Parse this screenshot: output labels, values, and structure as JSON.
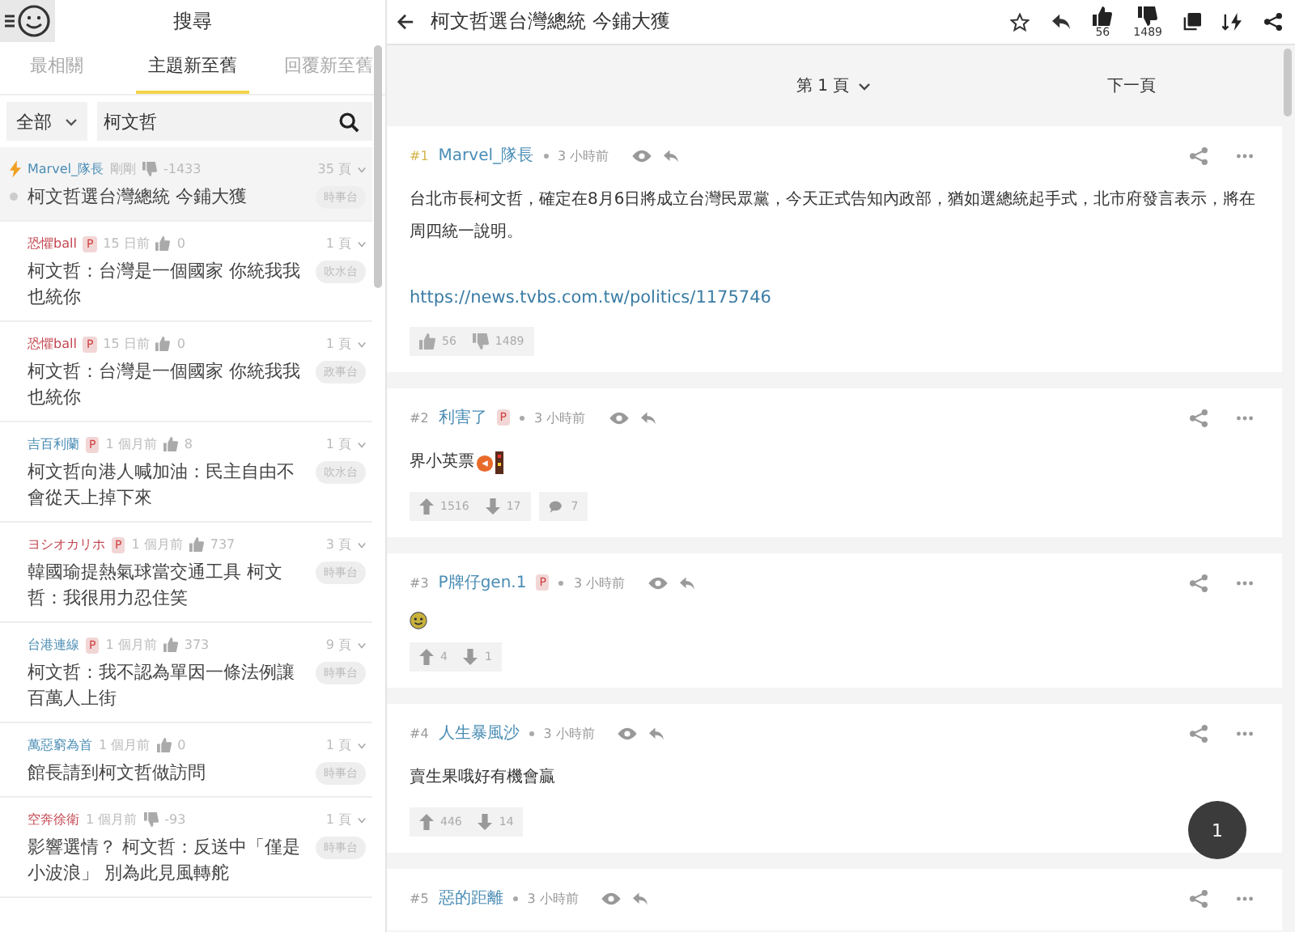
{
  "sidebar": {
    "title": "搜尋",
    "tabs": [
      {
        "label": "最相關",
        "selected": false
      },
      {
        "label": "主題新至舊",
        "selected": true
      },
      {
        "label": "回覆新至舊",
        "selected": false
      }
    ],
    "filter": {
      "value": "全部"
    },
    "search": {
      "value": "柯文哲"
    },
    "threads": [
      {
        "author": "Marvel_隊長",
        "color": "#4a8db5",
        "hot": true,
        "selected": true,
        "time": "剛剛",
        "vote": {
          "kind": "dislike",
          "count": "-1433"
        },
        "pages": "35 頁",
        "title": "柯文哲選台灣總統 今鋪大獲",
        "tag": "時事台"
      },
      {
        "author": "恐懼ball",
        "color": "#c4454f",
        "badge": "P",
        "hot": false,
        "selected": false,
        "time": "15 日前",
        "vote": {
          "kind": "like",
          "count": "0"
        },
        "pages": "1 頁",
        "title": "柯文哲：台灣是一個國家 你統我我也統你",
        "tag": "吹水台"
      },
      {
        "author": "恐懼ball",
        "color": "#c4454f",
        "badge": "P",
        "hot": false,
        "selected": false,
        "time": "15 日前",
        "vote": {
          "kind": "like",
          "count": "0"
        },
        "pages": "1 頁",
        "title": "柯文哲：台灣是一個國家 你統我我也統你",
        "tag": "政事台"
      },
      {
        "author": "吉百利蘭",
        "color": "#4a8db5",
        "badge": "P",
        "hot": false,
        "selected": false,
        "time": "1 個月前",
        "vote": {
          "kind": "like",
          "count": "8"
        },
        "pages": "1 頁",
        "title": "柯文哲向港人喊加油：民主自由不會從天上掉下來",
        "tag": "吹水台"
      },
      {
        "author": "ヨシオカリホ",
        "color": "#c4454f",
        "badge": "P",
        "hot": false,
        "selected": false,
        "time": "1 個月前",
        "vote": {
          "kind": "like",
          "count": "737"
        },
        "pages": "3 頁",
        "title": "韓國瑜提熱氣球當交通工具 柯文哲：我很用力忍住笑",
        "tag": "時事台"
      },
      {
        "author": "台港連線",
        "color": "#4a8db5",
        "badge": "P",
        "hot": false,
        "selected": false,
        "time": "1 個月前",
        "vote": {
          "kind": "like",
          "count": "373"
        },
        "pages": "9 頁",
        "title": "柯文哲：我不認為單因一條法例讓百萬人上街",
        "tag": "時事台"
      },
      {
        "author": "萬惡窮為首",
        "color": "#4a8db5",
        "hot": false,
        "selected": false,
        "time": "1 個月前",
        "vote": {
          "kind": "like",
          "count": "0"
        },
        "pages": "1 頁",
        "title": "館長請到柯文哲做訪問",
        "tag": "時事台"
      },
      {
        "author": "空奔徐衛",
        "color": "#c4454f",
        "hot": false,
        "selected": false,
        "time": "1 個月前",
        "vote": {
          "kind": "dislike",
          "count": "-93"
        },
        "pages": "1 頁",
        "title": "影響選情？ 柯文哲：反送中「僅是小波浪」 別為此見風轉舵",
        "tag": "時事台"
      }
    ]
  },
  "topic": {
    "title": "柯文哲選台灣總統 今鋪大獲",
    "likes": "56",
    "dislikes": "1489",
    "page": "第 1 頁",
    "next": "下一頁"
  },
  "posts": [
    {
      "number": "#1",
      "author": "Marvel_隊長",
      "color": "#4a8db5",
      "time": "3 小時前",
      "paragraphs": [
        "台北市長柯文哲，確定在8月6日將成立台灣民眾黨，今天正式告知內政部，猶如選總統起手式，北市府發言表示，將在周四統一說明。"
      ],
      "link": "https://news.tvbs.com.tw/politics/1175746",
      "reactions": [
        [
          {
            "kind": "like",
            "count": "56"
          },
          {
            "kind": "dislike",
            "count": "1489"
          }
        ]
      ]
    },
    {
      "number": "#2",
      "author": "利害了",
      "color": "#4a8db5",
      "badge": "P",
      "time": "3 小時前",
      "paragraphs": [
        "界小英票"
      ],
      "stickers": [
        {
          "kind": "face"
        },
        {
          "kind": "bar"
        }
      ],
      "reactions": [
        [
          {
            "kind": "up",
            "count": "1516"
          },
          {
            "kind": "down",
            "count": "17"
          }
        ],
        [
          {
            "kind": "comment",
            "count": "7"
          }
        ]
      ]
    },
    {
      "number": "#3",
      "author": "P牌仔gen.1",
      "color": "#4a8db5",
      "badge": "P",
      "time": "3 小時前",
      "stickers": [
        {
          "kind": "smile"
        }
      ],
      "reactions": [
        [
          {
            "kind": "up",
            "count": "4"
          },
          {
            "kind": "down",
            "count": "1"
          }
        ]
      ]
    },
    {
      "number": "#4",
      "author": "人生暴風沙",
      "color": "#4a8db5",
      "time": "3 小時前",
      "paragraphs": [
        "賣生果哦好有機會贏"
      ],
      "reactions": [
        [
          {
            "kind": "up",
            "count": "446"
          },
          {
            "kind": "down",
            "count": "14"
          }
        ]
      ]
    },
    {
      "number": "#5",
      "author": "惡的距離",
      "color": "#4a8db5",
      "time": "3 小時前"
    }
  ],
  "floating_badge": "1"
}
